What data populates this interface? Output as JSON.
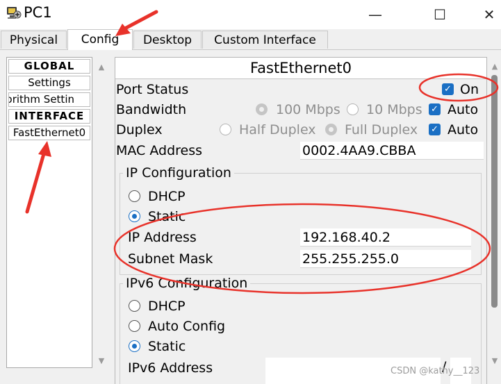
{
  "window": {
    "title": "PC1",
    "minimize": "—",
    "maximize": "☐",
    "close": "✕"
  },
  "tabs": [
    {
      "label": "Physical"
    },
    {
      "label": "Config",
      "active": true
    },
    {
      "label": "Desktop"
    },
    {
      "label": "Custom Interface"
    }
  ],
  "sidebar": {
    "items": [
      {
        "label": "GLOBAL",
        "type": "header"
      },
      {
        "label": "Settings"
      },
      {
        "label": "gorithm Settin"
      },
      {
        "label": "INTERFACE",
        "type": "header"
      },
      {
        "label": "FastEthernet0",
        "selected": true
      }
    ]
  },
  "panel": {
    "title": "FastEthernet0",
    "port_status": {
      "label": "Port Status",
      "checkbox_label": "On",
      "checked": true
    },
    "bandwidth": {
      "label": "Bandwidth",
      "opt1": "100 Mbps",
      "opt2": "10 Mbps",
      "auto": "Auto"
    },
    "duplex": {
      "label": "Duplex",
      "opt1": "Half Duplex",
      "opt2": "Full Duplex",
      "auto": "Auto"
    },
    "mac": {
      "label": "MAC Address",
      "value": "0002.4AA9.CBBA"
    },
    "ip_config": {
      "title": "IP Configuration",
      "dhcp": "DHCP",
      "static": "Static",
      "ip_label": "IP Address",
      "ip_value": "192.168.40.2",
      "mask_label": "Subnet Mask",
      "mask_value": "255.255.255.0"
    },
    "ipv6_config": {
      "title": "IPv6 Configuration",
      "dhcp": "DHCP",
      "auto": "Auto Config",
      "static": "Static",
      "addr_label": "IPv6 Address",
      "slash": "/"
    }
  },
  "annotation_color": "#e8322a",
  "accent_color": "#1a6fc4",
  "watermark": "CSDN @kathy__123"
}
